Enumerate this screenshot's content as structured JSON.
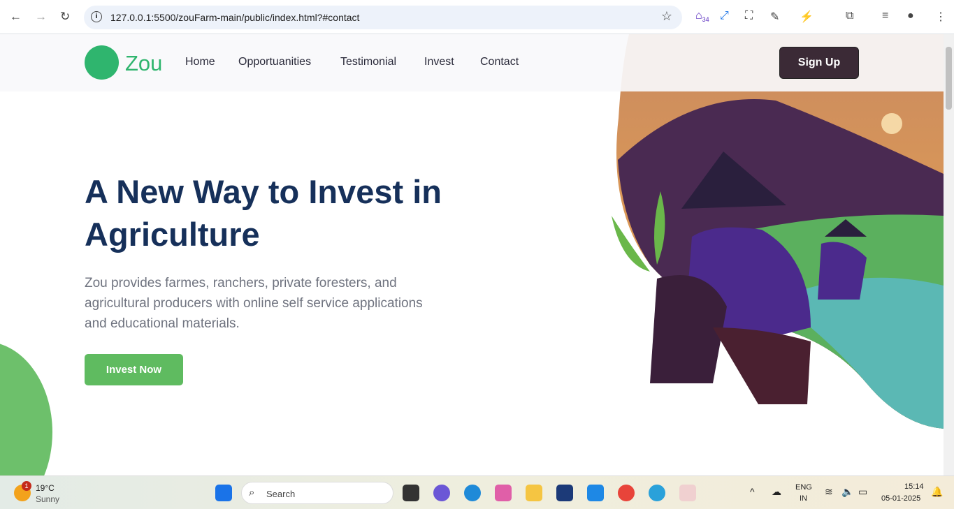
{
  "browser": {
    "url": "127.0.0.1:5500/zouFarm-main/public/index.html?#contact",
    "ext_badge": "34"
  },
  "nav": {
    "brand": "Zou",
    "links": [
      "Home",
      "Opportuanities",
      "Testimonial",
      "Invest",
      "Contact"
    ],
    "signup": "Sign Up"
  },
  "hero": {
    "title": "A New Way to Invest in Agriculture",
    "description": "Zou provides farmes, ranchers, private foresters, and agricultural producers with online self service applications and educational materials.",
    "cta": "Invest Now"
  },
  "colors": {
    "primary": "#16305a",
    "green": "#5fbb60",
    "brand": "#2fb56e",
    "signup": "#3b2a36"
  },
  "taskbar": {
    "weather_temp": "19°C",
    "weather_text": "Sunny",
    "weather_badge": "1",
    "search": "Search",
    "lang1": "ENG",
    "lang2": "IN",
    "time": "15:14",
    "date": "05-01-2025"
  }
}
